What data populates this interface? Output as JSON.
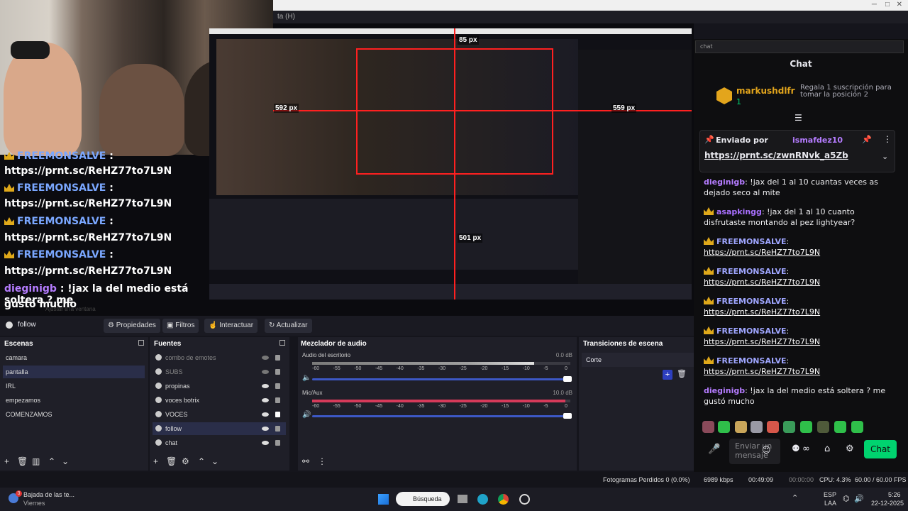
{
  "preview": {
    "obs_title_fragment": "ta (H)",
    "overlay_chat": [
      {
        "user": "FREEMONSALVE",
        "text": ":"
      },
      {
        "link": "https://prnt.sc/ReHZ77to7L9N"
      },
      {
        "user": "FREEMONSALVE",
        "text": ":"
      },
      {
        "link": "https://prnt.sc/ReHZ77to7L9N"
      },
      {
        "user": "FREEMONSALVE",
        "text": ":"
      },
      {
        "link": "https://prnt.sc/ReHZ77to7L9N"
      },
      {
        "user": "FREEMONSALVE",
        "text": ":"
      },
      {
        "link": "https://prnt.sc/ReHZ77to7L9N"
      },
      {
        "user": "dieginigb",
        "text": ": !jax la del medio está soltera ? me"
      },
      {
        "link": "gustó mucho"
      }
    ],
    "measure_labels": {
      "top": "85 px",
      "left": "592 px",
      "mid": "559 px",
      "bottom": "501 px"
    }
  },
  "toolbar": {
    "current_source": "follow",
    "properties": "Propiedades",
    "filters": "Filtros",
    "interact": "Interactuar",
    "refresh": "Actualizar",
    "faint_text": "Ajustar a la ventana"
  },
  "scenes": {
    "title": "Escenas",
    "items": [
      "camara",
      "pantalla",
      "IRL",
      "empezamos",
      "COMENZAMOS"
    ],
    "selected": "pantalla"
  },
  "sources": {
    "title": "Fuentes",
    "items": [
      "combo de emotes",
      "SUBS",
      "propinas",
      "voces botrix",
      "VOCES",
      "follow",
      "chat"
    ]
  },
  "mixer": {
    "title": "Mezclador de audio",
    "channels": [
      {
        "name": "Audio del escritorio",
        "db": "0.0 dB",
        "level_fraction": 0.86
      },
      {
        "name": "Mic/Aux",
        "db": "10.0 dB",
        "level_fraction": 0.98
      }
    ],
    "ticks": [
      "-60",
      "-55",
      "-50",
      "-45",
      "-40",
      "-35",
      "-30",
      "-25",
      "-20",
      "-15",
      "-10",
      "-5",
      "0"
    ]
  },
  "transitions": {
    "title": "Transiciones de escena",
    "current": "Corte"
  },
  "status": {
    "dropped": "Fotogramas Perdidos 0 (0.0%)",
    "bitrate": "6989 kbps",
    "live_time": "00:49:09",
    "rec_time": "00:00:00",
    "cpu": "CPU: 4.3%",
    "fps": "60.00 / 60.00 FPS"
  },
  "taskbar": {
    "news_title": "Bajada de las te...",
    "news_sub": "Viernes",
    "search": "Búsqueda",
    "lang": "ESP",
    "lang_sub": "LAA",
    "time": "5:26",
    "date": "22-12-2025",
    "badge": "3"
  },
  "chat": {
    "search_placeholder": "chat",
    "title": "Chat",
    "leader_user": "markushdlfr",
    "leader_count": "1",
    "leader_text": "Regala 1 suscripción para tomar la posición 2",
    "pinned_label": "Enviado por",
    "pinned_user": "ismafdez10",
    "pinned_link": "https://prnt.sc/zwnRNvk_a5Zb",
    "messages": [
      {
        "user": "dieginigb",
        "color": "#b57cff",
        "text": ": !jax del 1 al 10 cuantas veces as dejado seco al mite"
      },
      {
        "user": "asapkingg",
        "color": "#a970ff",
        "text": ": !jax del 1 al 10 cuanto disfrutaste montando al pez lightyear?"
      },
      {
        "user": "FREEMONSALVE",
        "color": "#9fa6ff",
        "text": ":",
        "link": "https://prnt.sc/ReHZ77to7L9N"
      },
      {
        "user": "FREEMONSALVE",
        "color": "#9fa6ff",
        "text": ":",
        "link": "https://prnt.sc/ReHZ77to7L9N"
      },
      {
        "user": "FREEMONSALVE",
        "color": "#9fa6ff",
        "text": ":",
        "link": "https://prnt.sc/ReHZ77to7L9N"
      },
      {
        "user": "FREEMONSALVE",
        "color": "#9fa6ff",
        "text": ":",
        "link": "https://prnt.sc/ReHZ77to7L9N"
      },
      {
        "user": "FREEMONSALVE",
        "color": "#9fa6ff",
        "text": ":",
        "link": "https://prnt.sc/ReHZ77to7L9N"
      },
      {
        "user": "dieginigb",
        "color": "#b57cff",
        "text": ": !jax la del medio está soltera ? me gustó mucho"
      }
    ],
    "input_placeholder": "Enviar un mensaje",
    "send": "Chat",
    "accent": "#00d36f"
  }
}
